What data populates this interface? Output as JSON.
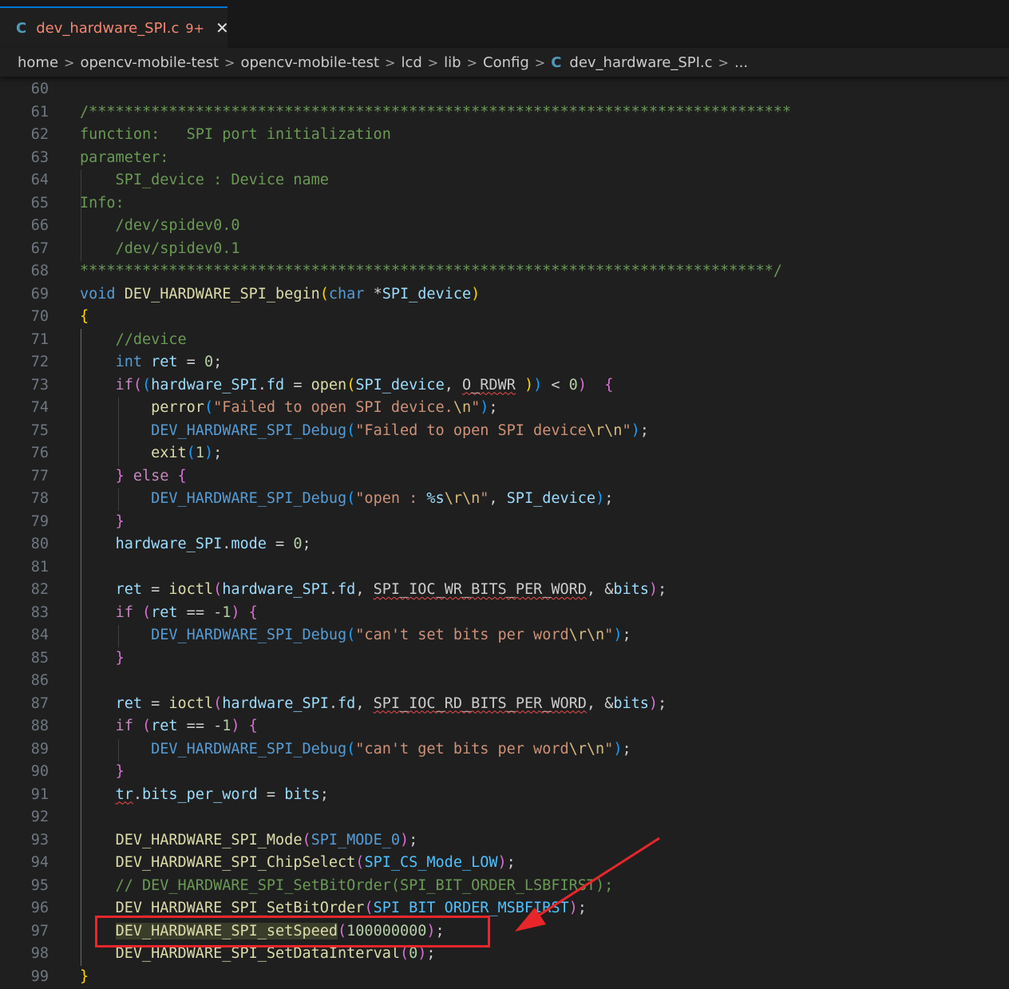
{
  "tab": {
    "name": "dev_hardware_SPI.c",
    "badge": "9+",
    "close_glyph": "✕",
    "lang_glyph": "C"
  },
  "breadcrumb": {
    "segments": [
      "home",
      "opencv-mobile-test",
      "opencv-mobile-test",
      "lcd",
      "lib",
      "Config",
      "dev_hardware_SPI.c",
      "..."
    ]
  },
  "code_lines": [
    {
      "n": "60"
    },
    {
      "n": "61"
    },
    {
      "n": "62"
    },
    {
      "n": "63"
    },
    {
      "n": "64"
    },
    {
      "n": "65"
    },
    {
      "n": "66"
    },
    {
      "n": "67"
    },
    {
      "n": "68"
    },
    {
      "n": "69"
    },
    {
      "n": "70"
    },
    {
      "n": "71"
    },
    {
      "n": "72"
    },
    {
      "n": "73"
    },
    {
      "n": "74"
    },
    {
      "n": "75"
    },
    {
      "n": "76"
    },
    {
      "n": "77"
    },
    {
      "n": "78"
    },
    {
      "n": "79"
    },
    {
      "n": "80"
    },
    {
      "n": "81"
    },
    {
      "n": "82"
    },
    {
      "n": "83"
    },
    {
      "n": "84"
    },
    {
      "n": "85"
    },
    {
      "n": "86"
    },
    {
      "n": "87"
    },
    {
      "n": "88"
    },
    {
      "n": "89"
    },
    {
      "n": "90"
    },
    {
      "n": "91"
    },
    {
      "n": "92"
    },
    {
      "n": "93"
    },
    {
      "n": "94"
    },
    {
      "n": "95"
    },
    {
      "n": "96"
    },
    {
      "n": "97"
    },
    {
      "n": "98"
    },
    {
      "n": "99"
    }
  ],
  "colors": {
    "annotation": "#e8262a",
    "keyword": "#569cd6",
    "function": "#dcdcaa",
    "string": "#ce9178",
    "comment": "#6a9955"
  }
}
